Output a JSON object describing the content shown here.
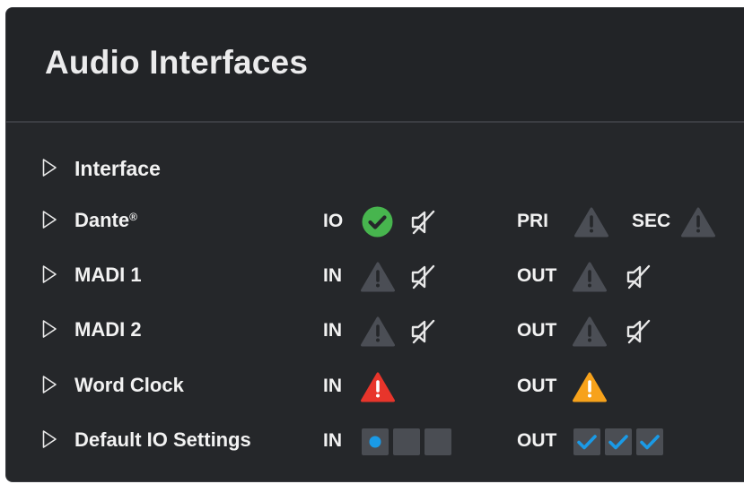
{
  "panel": {
    "title": "Audio Interfaces"
  },
  "header_row": {
    "label": "Interface"
  },
  "rows": [
    {
      "name": "Dante",
      "trademark": "®",
      "io_label": "IO",
      "io_status": "ok",
      "io_extra": "mute",
      "pri_label": "PRI",
      "pri_status": "warning-grey",
      "sec_label": "SEC",
      "sec_status": "warning-grey"
    },
    {
      "name": "MADI 1",
      "in_label": "IN",
      "in_status": "warning-grey",
      "in_extra": "mute",
      "out_label": "OUT",
      "out_status": "warning-grey",
      "out_extra": "mute"
    },
    {
      "name": "MADI 2",
      "in_label": "IN",
      "in_status": "warning-grey",
      "in_extra": "mute",
      "out_label": "OUT",
      "out_status": "warning-grey",
      "out_extra": "mute"
    },
    {
      "name": "Word Clock",
      "in_label": "IN",
      "in_status": "error-red",
      "out_label": "OUT",
      "out_status": "warning-orange"
    },
    {
      "name": "Default IO Settings",
      "in_label": "IN",
      "in_options": [
        "selected",
        "empty",
        "empty"
      ],
      "out_label": "OUT",
      "out_options": [
        "checked",
        "checked",
        "checked"
      ]
    }
  ],
  "colors": {
    "background": "#25272a",
    "ok": "#47b54e",
    "warning_grey": "#4b4e55",
    "error_red": "#e8352b",
    "warning_orange": "#f7a21b",
    "accent_blue": "#1a9ae6"
  }
}
